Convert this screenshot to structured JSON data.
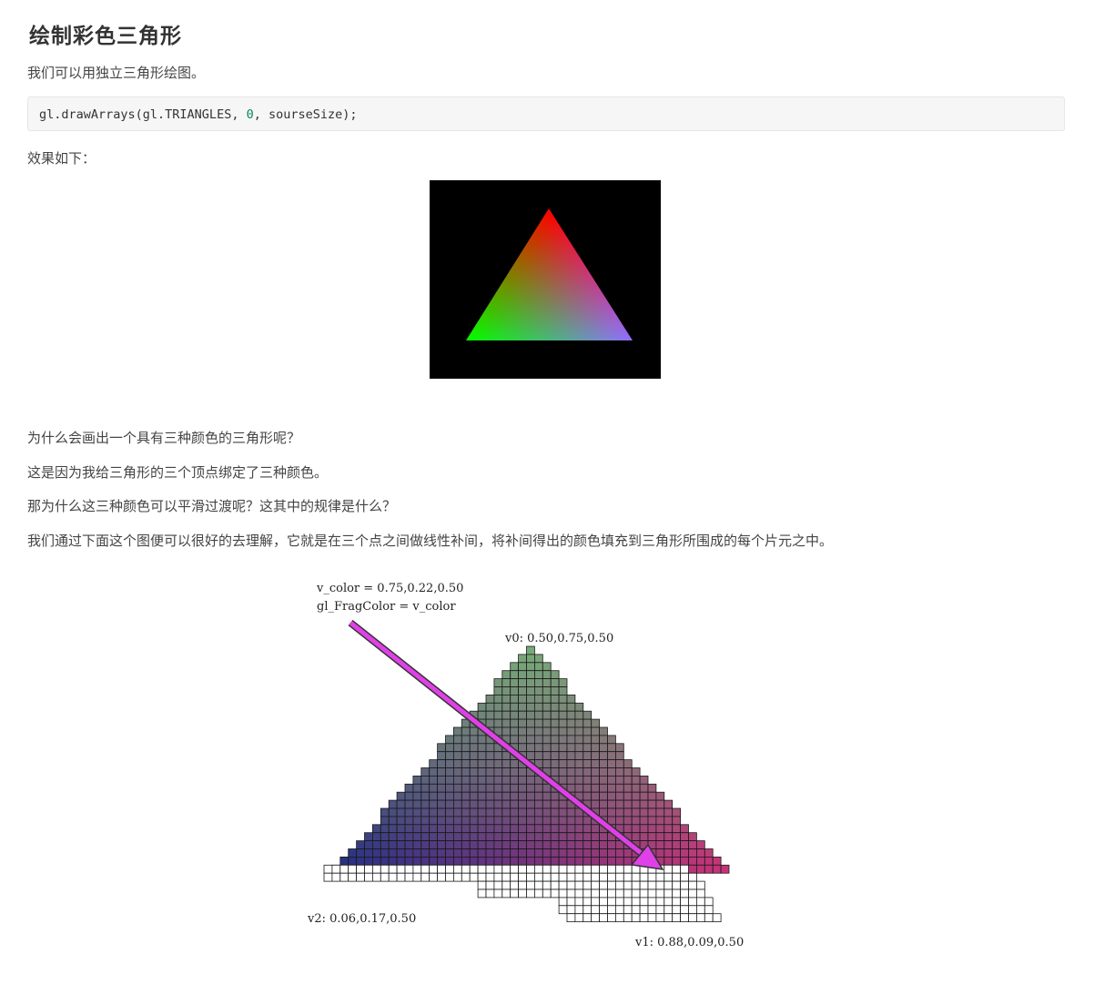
{
  "heading": "绘制彩色三角形",
  "intro": "我们可以用独立三角形绘图。",
  "code": {
    "prefix": "gl.drawArrays(gl.TRIANGLES, ",
    "number": "0",
    "suffix": ", sourseSize);"
  },
  "effect_label": "效果如下：",
  "question1": "为什么会画出一个具有三种颜色的三角形呢？",
  "answer1": "这是因为我给三角形的三个顶点绑定了三种颜色。",
  "question2": "那为什么这三种颜色可以平滑过渡呢？这其中的规律是什么？",
  "explanation": "我们通过下面这个图便可以很好的去理解，它就是在三个点之间做线性补间，将补间得出的颜色填充到三角形所围成的每个片元之中。",
  "rendered_triangle": {
    "vertex_colors": {
      "top": "#ff0000",
      "left": "#00ff00",
      "right": "#0000ff"
    }
  },
  "diagram": {
    "label_line1": "v_color = 0.75,0.22,0.50",
    "label_line2": "gl_FragColor = v_color",
    "v0_label": "v0: 0.50,0.75,0.50",
    "v1_label": "v1: 0.88,0.09,0.50",
    "v2_label": "v2: 0.06,0.17,0.50",
    "arrow_color": "#e040e8"
  }
}
